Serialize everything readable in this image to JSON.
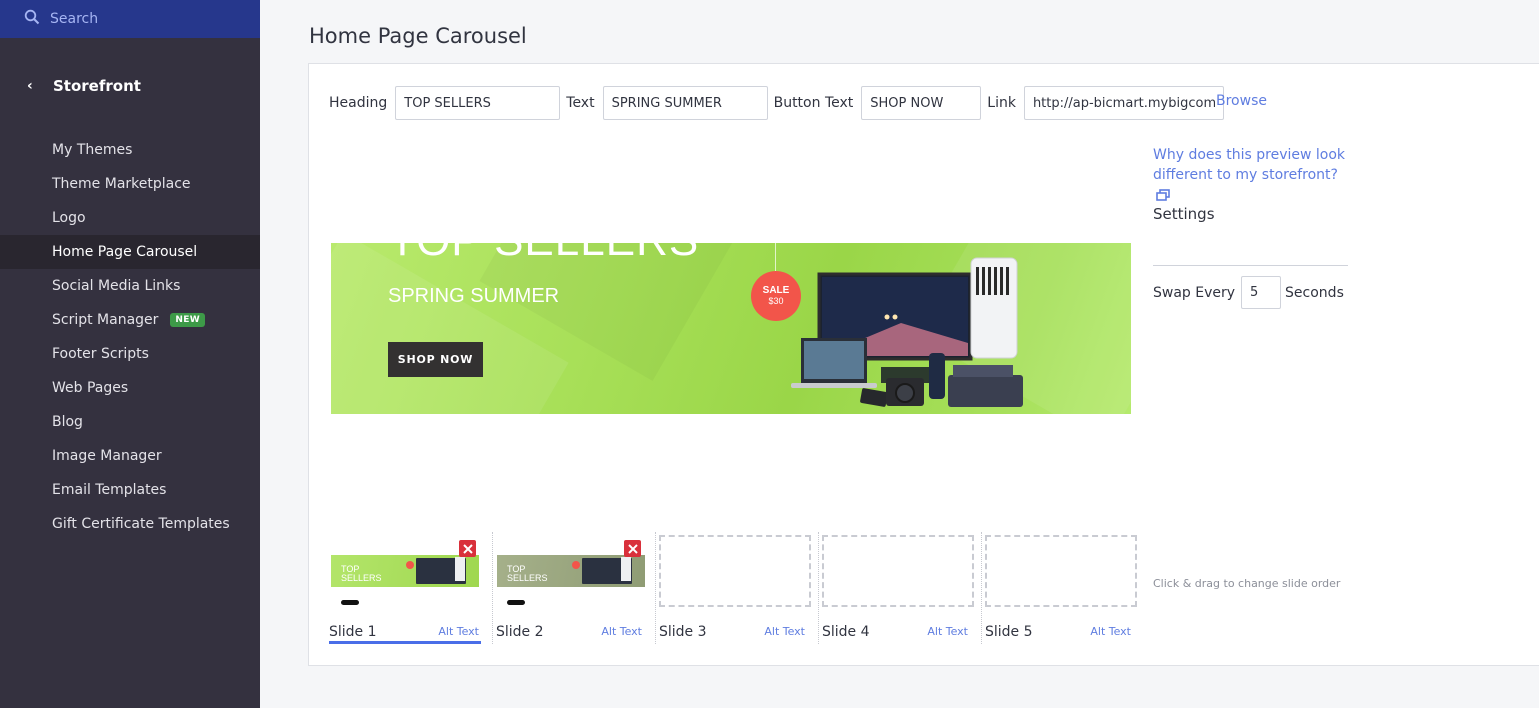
{
  "sidebar": {
    "search_placeholder": "Search",
    "section_title": "Storefront",
    "back_icon": "chevron-left-icon",
    "items": [
      {
        "label": "My Themes",
        "active": false
      },
      {
        "label": "Theme Marketplace",
        "active": false
      },
      {
        "label": "Logo",
        "active": false
      },
      {
        "label": "Home Page Carousel",
        "active": true
      },
      {
        "label": "Social Media Links",
        "active": false
      },
      {
        "label": "Script Manager",
        "active": false,
        "badge": "NEW"
      },
      {
        "label": "Footer Scripts",
        "active": false
      },
      {
        "label": "Web Pages",
        "active": false
      },
      {
        "label": "Blog",
        "active": false
      },
      {
        "label": "Image Manager",
        "active": false
      },
      {
        "label": "Email Templates",
        "active": false
      },
      {
        "label": "Gift Certificate Templates",
        "active": false
      }
    ]
  },
  "page": {
    "title": "Home Page Carousel"
  },
  "fields": {
    "heading_label": "Heading",
    "heading_value": "TOP SELLERS",
    "text_label": "Text",
    "text_value": "SPRING SUMMER",
    "button_text_label": "Button Text",
    "button_text_value": "SHOP NOW",
    "link_label": "Link",
    "link_value": "http://ap-bicmart.mybigcommerce.com",
    "browse_label": "Browse"
  },
  "preview": {
    "heading": "TOP SELLERS",
    "text": "SPRING SUMMER",
    "button": "SHOP NOW",
    "sale_label": "SALE",
    "sale_price": "$30"
  },
  "settings": {
    "help_link": "Why does this preview look different to my storefront?",
    "title": "Settings",
    "swap_label": "Swap Every",
    "swap_value": "5",
    "seconds_label": "Seconds",
    "drag_hint": "Click & drag to change slide order"
  },
  "slides": [
    {
      "label": "Slide 1",
      "alt": "Alt Text",
      "has_image": true,
      "thumb_text": "TOP SELLERS",
      "selected": true
    },
    {
      "label": "Slide 2",
      "alt": "Alt Text",
      "has_image": true,
      "thumb_text": "TOP SELLERS",
      "selected": false
    },
    {
      "label": "Slide 3",
      "alt": "Alt Text",
      "has_image": false,
      "selected": false
    },
    {
      "label": "Slide 4",
      "alt": "Alt Text",
      "has_image": false,
      "selected": false
    },
    {
      "label": "Slide 5",
      "alt": "Alt Text",
      "has_image": false,
      "selected": false
    }
  ],
  "colors": {
    "accent": "#5f7de0",
    "sidebar_bg": "#34313f",
    "search_bg": "#26378c",
    "new_badge": "#3d9a48",
    "delete": "#d9303b",
    "banner_green": "#a7df57"
  }
}
